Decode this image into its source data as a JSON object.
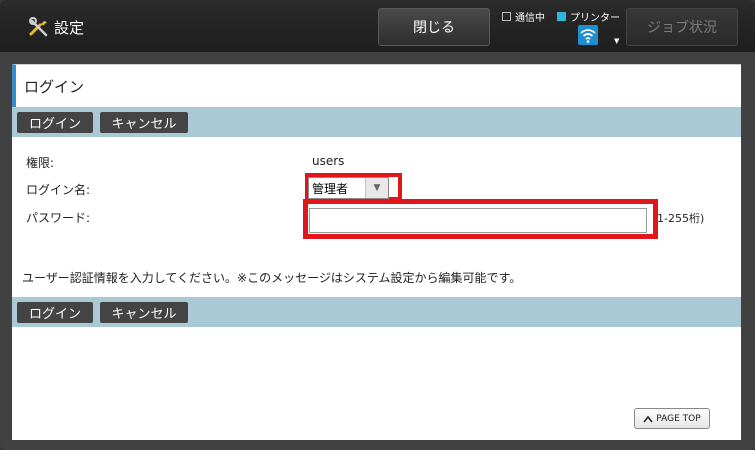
{
  "topbar": {
    "settings_label": "設定",
    "close_label": "閉じる",
    "status": {
      "communicating_label": "通信中",
      "printer_label": "プリンター"
    },
    "job_status_label": "ジョブ状況"
  },
  "page": {
    "title": "ログイン",
    "login_button": "ログイン",
    "cancel_button": "キャンセル"
  },
  "form": {
    "authority_label": "権限:",
    "authority_value": "users",
    "login_name_label": "ログイン名:",
    "login_name_value": "管理者",
    "password_label": "パスワード:",
    "password_value": "",
    "password_hint": "1-255桁)"
  },
  "message": "ユーザー認証情報を入力してください。※このメッセージはシステム設定から編集可能です。",
  "footer": {
    "page_top_label": "PAGE TOP"
  },
  "colors": {
    "accent_bar": "#a9cad5",
    "highlight": "#e1161c",
    "title_accent": "#3a8cc9"
  }
}
